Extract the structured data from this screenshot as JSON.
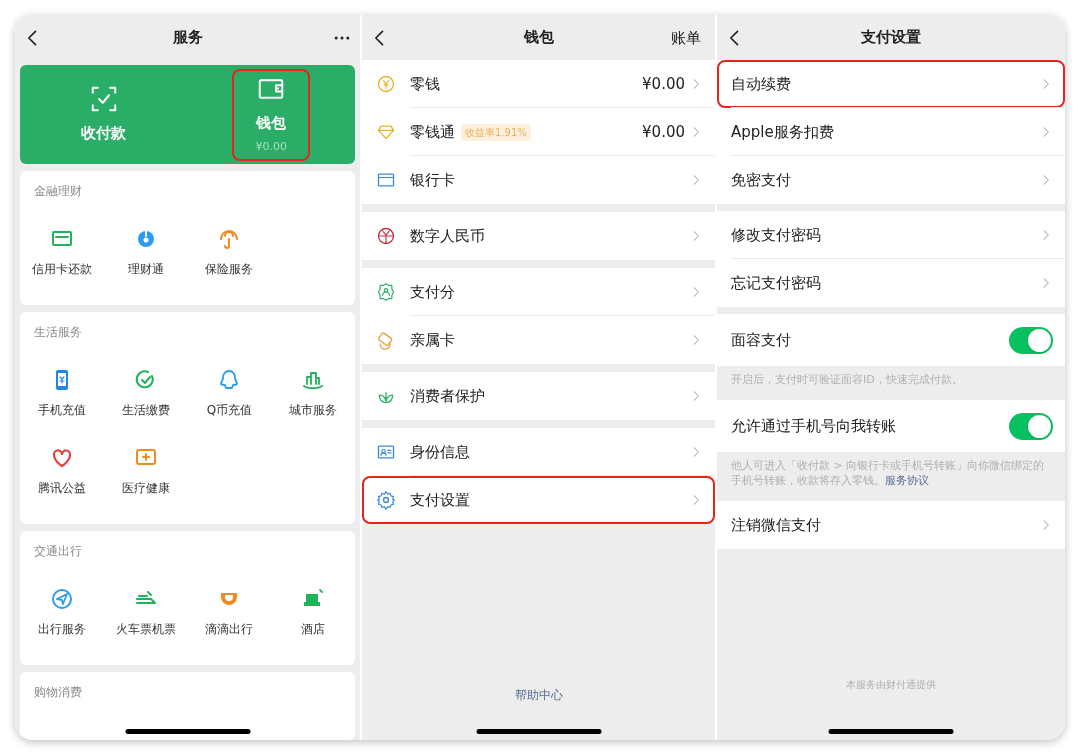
{
  "services_screen": {
    "title": "服务",
    "top_card": [
      {
        "label": "收付款",
        "highlighted": false
      },
      {
        "label": "钱包",
        "amount": "¥0.00",
        "highlighted": true
      }
    ],
    "sections": [
      {
        "title": "金融理财",
        "items": [
          "信用卡还款",
          "理财通",
          "保险服务"
        ]
      },
      {
        "title": "生活服务",
        "items": [
          "手机充值",
          "生活缴费",
          "Q币充值",
          "城市服务",
          "腾讯公益",
          "医疗健康"
        ]
      },
      {
        "title": "交通出行",
        "items": [
          "出行服务",
          "火车票机票",
          "滴滴出行",
          "酒店"
        ]
      },
      {
        "title": "购物消费"
      }
    ]
  },
  "wallet_screen": {
    "title": "钱包",
    "action": "账单",
    "groups": [
      {
        "items": [
          {
            "label": "零钱",
            "value": "¥0.00",
            "highlighted": false
          },
          {
            "label": "零钱通",
            "badge": "收益率1.91%",
            "value": "¥0.00",
            "highlighted": false
          },
          {
            "label": "银行卡",
            "highlighted": false
          }
        ]
      },
      {
        "items": [
          {
            "label": "数字人民币",
            "highlighted": false
          }
        ]
      },
      {
        "items": [
          {
            "label": "支付分",
            "highlighted": false
          },
          {
            "label": "亲属卡",
            "highlighted": false
          }
        ]
      },
      {
        "items": [
          {
            "label": "消费者保护",
            "highlighted": false
          }
        ]
      },
      {
        "items": [
          {
            "label": "身份信息",
            "highlighted": false
          },
          {
            "label": "支付设置",
            "highlighted": true
          }
        ]
      }
    ],
    "footer_link": "帮助中心"
  },
  "pay_settings_screen": {
    "title": "支付设置",
    "groups": [
      {
        "items": [
          {
            "kind": "link",
            "label": "自动续费",
            "highlighted": true
          },
          {
            "kind": "link",
            "label": "Apple服务扣费",
            "highlighted": false
          },
          {
            "kind": "link",
            "label": "免密支付",
            "highlighted": false
          }
        ]
      },
      {
        "items": [
          {
            "kind": "link",
            "label": "修改支付密码",
            "highlighted": false
          },
          {
            "kind": "link",
            "label": "忘记支付密码",
            "highlighted": false
          }
        ]
      },
      {
        "items": [
          {
            "kind": "toggle",
            "label": "面容支付",
            "on": true,
            "highlighted": false
          }
        ],
        "note": "开启后，支付时可验证面容ID，快速完成付款。"
      },
      {
        "items": [
          {
            "kind": "toggle",
            "label": "允许通过手机号向我转账",
            "on": true,
            "highlighted": false
          }
        ],
        "note": "他人可进入「收付款 > 向银行卡或手机号转账」向你微信绑定的手机号转账，收款将存入零钱。",
        "note_link": "服务协议"
      },
      {
        "items": [
          {
            "kind": "link",
            "label": "注销微信支付",
            "highlighted": false
          }
        ]
      }
    ],
    "footer": "本服务由财付通提供"
  }
}
